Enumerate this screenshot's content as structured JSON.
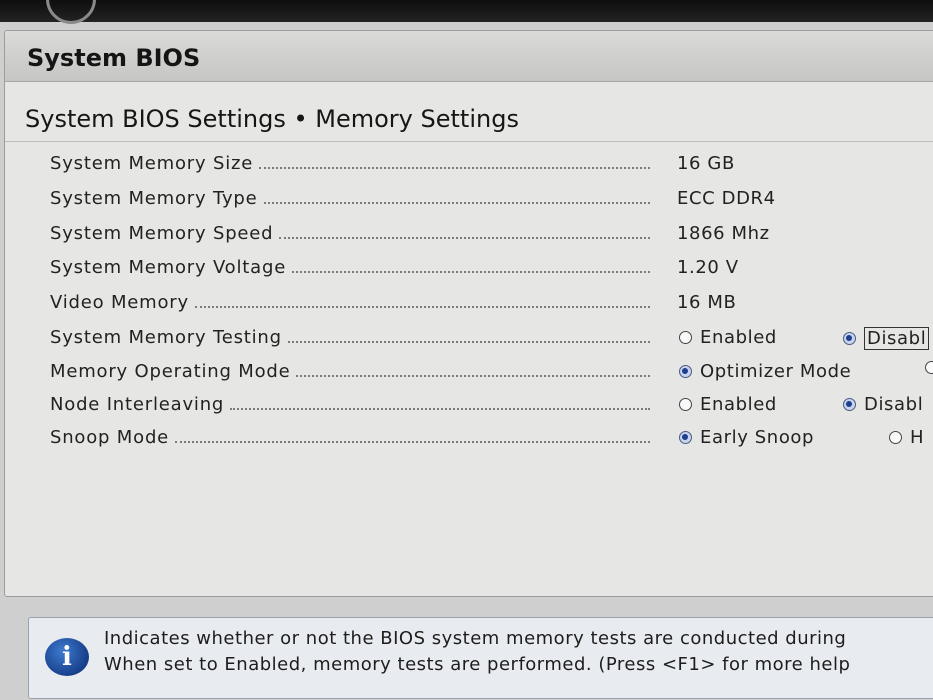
{
  "window": {
    "title": "System BIOS"
  },
  "breadcrumb": {
    "text": "System BIOS Settings • Memory Settings"
  },
  "settings": [
    {
      "label": "System Memory Size",
      "value": "16 GB"
    },
    {
      "label": "System Memory Type",
      "value": "ECC DDR4"
    },
    {
      "label": "System Memory Speed",
      "value": "1866 Mhz"
    },
    {
      "label": "System Memory Voltage",
      "value": "1.20 V"
    },
    {
      "label": "Video Memory",
      "value": "16 MB"
    },
    {
      "label": "System Memory Testing",
      "options": [
        "Enabled",
        "Disabl"
      ],
      "selected": "Disabl"
    },
    {
      "label": "Memory Operating Mode",
      "options": [
        "Optimizer Mode"
      ],
      "selected": "Optimizer Mode"
    },
    {
      "label": "Node Interleaving",
      "options": [
        "Enabled",
        "Disabl"
      ],
      "selected": "Disabl"
    },
    {
      "label": "Snoop Mode",
      "options": [
        "Early Snoop",
        "H"
      ],
      "selected": "Early Snoop"
    }
  ],
  "help": {
    "icon": "info-icon",
    "line1": "Indicates whether or not the BIOS system memory tests are conducted during",
    "line2": "When set to Enabled, memory tests are performed. (Press <F1> for more help"
  },
  "colors": {
    "radio_selected": "#1e3f8c",
    "help_icon": "#2a5db0"
  }
}
